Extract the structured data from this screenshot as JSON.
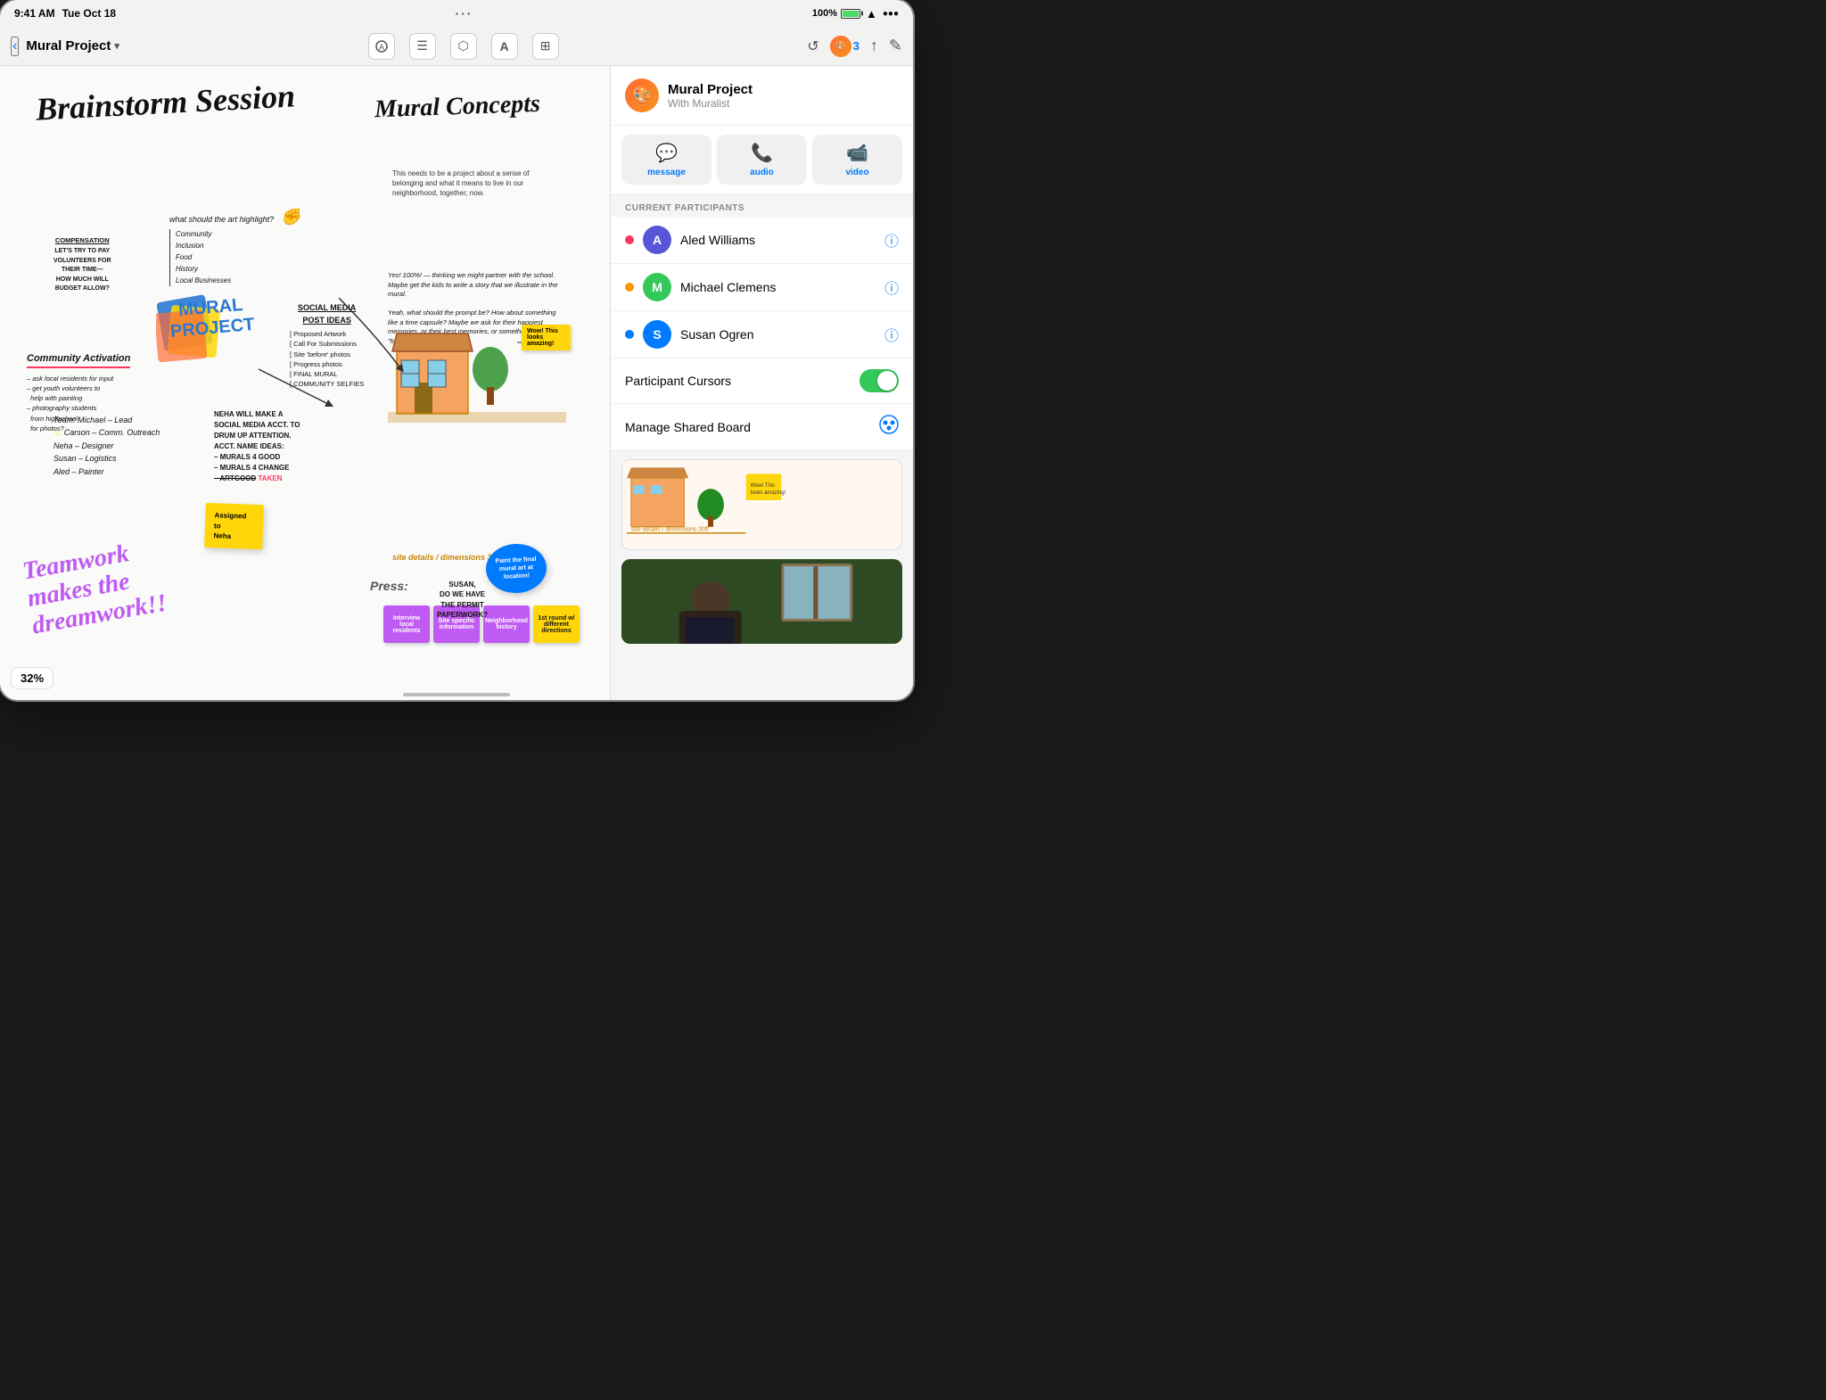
{
  "statusBar": {
    "time": "9:41 AM",
    "date": "Tue Oct 18",
    "battery": "100%",
    "dots": "···"
  },
  "toolbar": {
    "backLabel": "‹",
    "projectName": "Mural Project",
    "dropdownArrow": "▾",
    "tools": [
      {
        "name": "pencil",
        "icon": "A",
        "active": false
      },
      {
        "name": "text",
        "icon": "≡",
        "active": false
      },
      {
        "name": "shapes",
        "icon": "⬡",
        "active": false
      },
      {
        "name": "font",
        "icon": "A",
        "active": false
      },
      {
        "name": "image",
        "icon": "⊞",
        "active": false
      }
    ],
    "dotsIcon": "···",
    "historyIcon": "↺",
    "collaboratorsCount": "3",
    "shareIcon": "↑",
    "editIcon": "✎"
  },
  "panel": {
    "title": "Mural Project",
    "subtitle": "With Muralist",
    "avatarEmoji": "🎨",
    "commButtons": [
      {
        "label": "message",
        "icon": "💬"
      },
      {
        "label": "audio",
        "icon": "📞"
      },
      {
        "label": "video",
        "icon": "📹"
      }
    ],
    "sectionLabel": "CURRENT PARTICIPANTS",
    "participants": [
      {
        "name": "Aled Williams",
        "dotColor": "#ff375f",
        "avatarColor": "#5856d6",
        "initial": "A"
      },
      {
        "name": "Michael Clemens",
        "dotColor": "#ff9500",
        "avatarColor": "#34c759",
        "initial": "M"
      },
      {
        "name": "Susan Ogren",
        "dotColor": "#007aff",
        "avatarColor": "#007aff",
        "initial": "S"
      }
    ],
    "cursorLabel": "Participant Cursors",
    "cursorToggle": true,
    "manageLabel": "Manage Shared Board"
  },
  "canvas": {
    "brainstormTitle": "Brainstorm Session",
    "muralConceptsTitle": "Mural Concepts",
    "compensationTitle": "COMPENSATION",
    "compensationBody": "LET'S TRY TO PAY\nVOLUNTEERS FOR\nTHEIR TIME—\nHOW MUCH WILL\nBUDGET ALLOW?",
    "communityActivationTitle": "Community Activation",
    "communityItems": [
      "– ask local residents for input",
      "– get youth volunteers to",
      "  help with painting",
      "– photography students",
      "  from highschool",
      "  for photos?"
    ],
    "artHighlight": "what should the art highlight?",
    "artItems": [
      "Community",
      "Inclusion",
      "Food",
      "History",
      "Local Businesses"
    ],
    "socialHeader": "SOCIAL MEDIA\nPOST IDEAS",
    "socialItems": [
      "[ Proposed Artwork",
      "[ Call For Submissions",
      "[ Site 'before' photos",
      "[ Progress photos",
      "[ FINAL MURAL",
      "[ COMMUNITY SELFIES"
    ],
    "teamBlock": "Team: Michael – Lead\nCarson – Comm. Outreach\nNeha – Designer\nSusan – Logistics\nAled – Painter",
    "nehaBlock": "NEHA WILL MAKE A\nSOCIAL MEDIA ACCT. TO\nDRUM UP ATTENTION.\nACCT. NAME IDEAS:\n– MURALS 4 GOOD\n– Murals 4 Change\n– ArtGood TAKEN",
    "teamworkText": "Teamwork\nmakes the\ndreamwork!!",
    "muralDesc": "This needs to be a project about a sense of belonging and what it means to live in our neighborhood, together, now.",
    "yesBlock": "Yes! 100%! — thinking we might partner with the school. Maybe get the kids to write a story that we illustrate in the mural.\n\nYeah, what should the prompt be? How about something like a time capsule? Maybe we ask for their happiest memories, or their best memories, or something like what \"home\" means to them?",
    "siteDetails": "site details / dimensions 30ft",
    "pressLabel": "Press:",
    "susanBlock": "SUSAN,\nDO WE HAVE\nTHE PERMIT\nPAPERWORK?",
    "assignedNote": "Assigned to\nNeha",
    "stickyGrid": [
      [
        {
          "color": "#bf5af2",
          "text": "Interview\nlocal residents"
        },
        {
          "color": "#bf5af2",
          "text": "Site specific\ninformation"
        },
        {
          "color": "#bf5af2",
          "text": "Neighborhood\nhistory"
        },
        {
          "color": "#ffd60a",
          "text": "1st round w/\ndifferent\ndirections"
        }
      ]
    ],
    "zoomLevel": "32%"
  }
}
